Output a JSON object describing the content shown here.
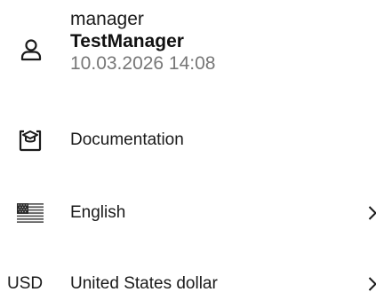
{
  "user": {
    "role": "manager",
    "name": "TestManager",
    "timestamp": "10.03.2026 14:08",
    "icon": "user-icon"
  },
  "menu": {
    "documentation": {
      "label": "Documentation",
      "icon": "graduation-cap-icon"
    },
    "language": {
      "label": "English",
      "icon": "us-flag-icon"
    },
    "currency": {
      "code": "USD",
      "label": "United States dollar"
    }
  },
  "colors": {
    "text": "#1a1a1a",
    "muted": "#777777",
    "background": "#ffffff"
  }
}
